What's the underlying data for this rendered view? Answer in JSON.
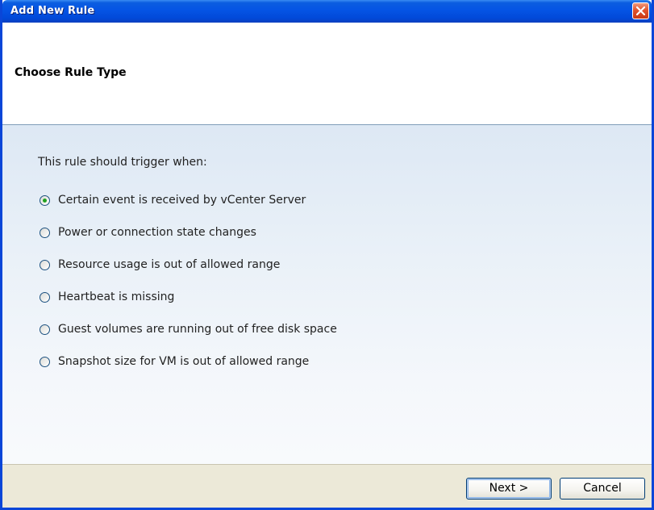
{
  "window": {
    "title": "Add New Rule",
    "close_icon": "close-icon"
  },
  "header": {
    "title": "Choose Rule Type"
  },
  "content": {
    "prompt": "This rule should trigger when:",
    "options": [
      {
        "label": "Certain event is received by vCenter Server",
        "selected": true
      },
      {
        "label": "Power or connection state changes",
        "selected": false
      },
      {
        "label": "Resource usage is out of allowed range",
        "selected": false
      },
      {
        "label": "Heartbeat is missing",
        "selected": false
      },
      {
        "label": "Guest volumes are running out of free disk space",
        "selected": false
      },
      {
        "label": "Snapshot size for VM is out of allowed range",
        "selected": false
      }
    ]
  },
  "footer": {
    "next_label": "Next >",
    "cancel_label": "Cancel"
  },
  "colors": {
    "titlebar": "#0554e4",
    "close_button": "#e1532d",
    "radio_selected_dot": "#21a121",
    "footer_bg": "#ece9d8"
  }
}
